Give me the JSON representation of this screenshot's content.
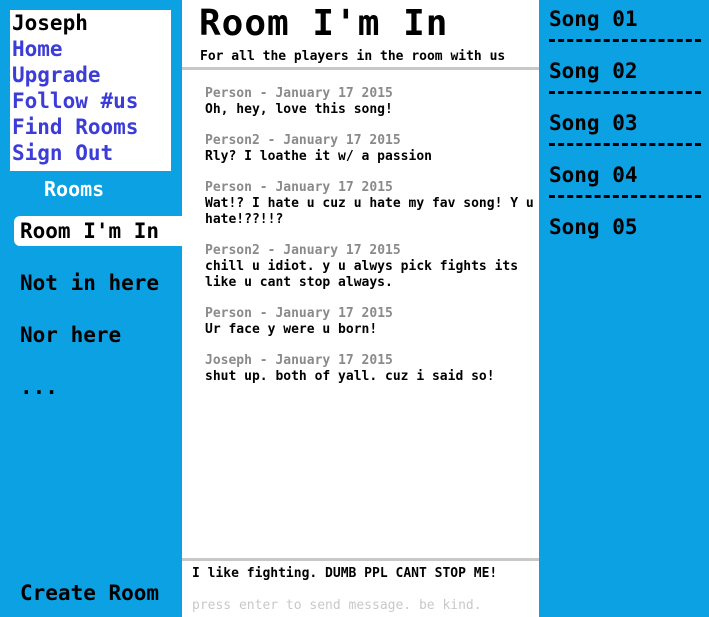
{
  "user_menu": {
    "username": "Joseph",
    "links": [
      "Home",
      "Upgrade",
      "Follow #us",
      "Find Rooms",
      "Sign Out"
    ]
  },
  "rooms": {
    "heading": "Rooms",
    "items": [
      "Room I'm In",
      "Not in here",
      "Nor here",
      "..."
    ],
    "create_label": "Create Room"
  },
  "room": {
    "title": "Room I'm In",
    "subtitle": "For all the players in the room with us"
  },
  "messages": [
    {
      "author": "Person",
      "date": "January 17 2015",
      "text": "Oh, hey, love this song!"
    },
    {
      "author": "Person2",
      "date": "January 17 2015",
      "text": "Rly? I loathe it w/ a passion"
    },
    {
      "author": "Person",
      "date": "January 17 2015",
      "text": "Wat!? I hate u cuz u hate my fav song! Y u hate!??!!?"
    },
    {
      "author": "Person2",
      "date": "January 17 2015",
      "text": "chill u idiot. y u alwys pick fights its like u cant stop always."
    },
    {
      "author": "Person",
      "date": "January 17 2015",
      "text": "Ur face y were u born!"
    },
    {
      "author": "Joseph",
      "date": "January 17 2015",
      "text": "shut up. both of yall. cuz i said so!"
    }
  ],
  "composer": {
    "value": "I like fighting. DUMB PPL CANT STOP ME!",
    "hint": "press enter to send message. be kind."
  },
  "songs": [
    "Song 01",
    "Song 02",
    "Song 03",
    "Song 04",
    "Song 05"
  ],
  "colors": {
    "accent": "#0ba1e2",
    "link": "#3c3cd8",
    "meta": "#8a8a8a",
    "rule": "#c8c8c8"
  }
}
